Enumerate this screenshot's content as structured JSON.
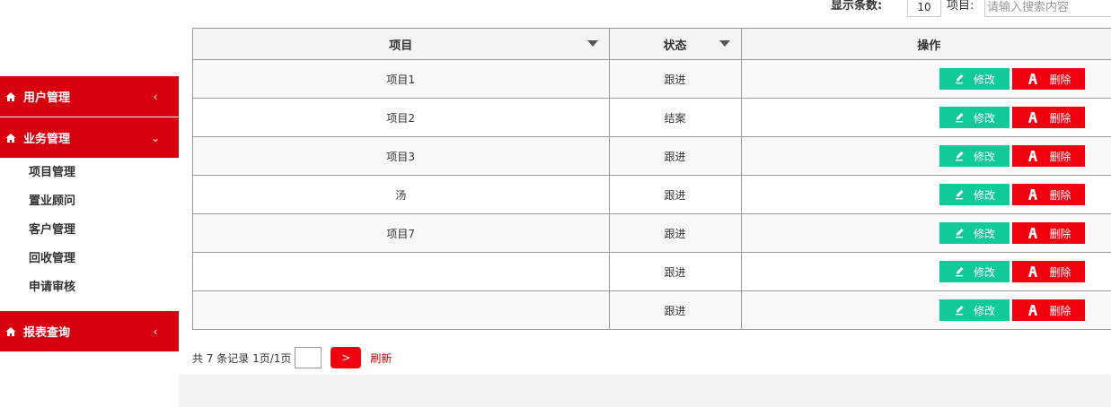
{
  "colors": {
    "primary_red": "#d7000f",
    "delete_red": "#f0000f",
    "edit_green": "#12c99a",
    "refresh_text": "#c00000"
  },
  "topbar": {
    "page_size_label": "显示条数:",
    "page_size_value": "10",
    "item_label": "项目:",
    "search_placeholder": "请输入搜索内容"
  },
  "sidebar": {
    "menus": [
      {
        "label": "用户管理",
        "icon": "home-icon",
        "chevron": "‹"
      },
      {
        "label": "业务管理",
        "icon": "home-icon",
        "chevron": "⌄"
      },
      {
        "label": "报表查询",
        "icon": "home-icon",
        "chevron": "‹"
      }
    ],
    "business_sub_items": [
      "项目管理",
      "置业顾问",
      "客户管理",
      "回收管理",
      "申请审核"
    ]
  },
  "table": {
    "headers": {
      "project": "项目",
      "status": "状态",
      "actions": "操作"
    },
    "rows": [
      {
        "project": "项目1",
        "status": "跟进"
      },
      {
        "project": "项目2",
        "status": "结案"
      },
      {
        "project": "项目3",
        "status": "跟进"
      },
      {
        "project": "汤",
        "status": "跟进"
      },
      {
        "project": "项目7",
        "status": "跟进"
      },
      {
        "project": "",
        "status": "跟进"
      },
      {
        "project": "",
        "status": "跟进"
      }
    ],
    "edit_label": "修改",
    "delete_label": "删除"
  },
  "pager": {
    "summary": "共 7 条记录 1页/1页",
    "next_label": ">",
    "refresh_label": "刷新"
  }
}
